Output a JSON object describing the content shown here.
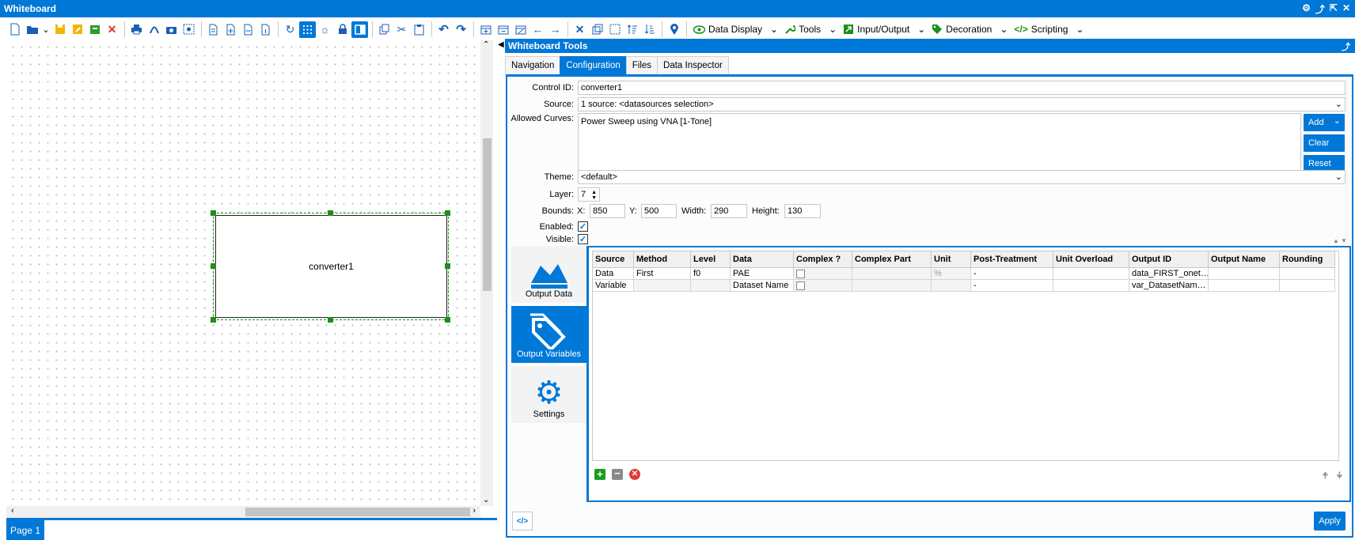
{
  "window": {
    "title": "Whiteboard"
  },
  "toolbar": {
    "menus": [
      {
        "label": "Data Display"
      },
      {
        "label": "Tools"
      },
      {
        "label": "Input/Output"
      },
      {
        "label": "Decoration"
      },
      {
        "label": "Scripting"
      }
    ]
  },
  "canvas": {
    "element_label": "converter1",
    "page_tab": "Page 1"
  },
  "panel": {
    "title": "Whiteboard Tools",
    "tabs": [
      "Navigation",
      "Configuration",
      "Files",
      "Data Inspector"
    ],
    "active_tab": "Configuration",
    "form": {
      "control_id_label": "Control ID:",
      "control_id": "converter1",
      "source_label": "Source:",
      "source": "1 source: <datasources selection>",
      "allowed_curves_label": "Allowed Curves:",
      "allowed_curves": "Power Sweep using VNA [1-Tone]",
      "add_label": "Add",
      "clear_label": "Clear",
      "reset_label": "Reset",
      "theme_label": "Theme:",
      "theme": "<default>",
      "layer_label": "Layer:",
      "layer": "7",
      "bounds_label": "Bounds:",
      "x_label": "X:",
      "x": "850",
      "y_label": "Y:",
      "y": "500",
      "width_label": "Width:",
      "width": "290",
      "height_label": "Height:",
      "height": "130",
      "enabled_label": "Enabled:",
      "visible_label": "Visible:",
      "enabled": true,
      "visible": true
    },
    "side_nav": [
      "Output Data",
      "Output Variables",
      "Settings"
    ],
    "table": {
      "columns": [
        "Source",
        "Method",
        "Level",
        "Data",
        "Complex ?",
        "Complex Part",
        "Unit",
        "Post-Treatment",
        "Unit Overload",
        "Output ID",
        "Output Name",
        "Rounding"
      ],
      "rows": [
        {
          "source": "Data",
          "method": "First",
          "level": "f0",
          "data": "PAE",
          "complex": false,
          "complex_part": "",
          "unit": "%",
          "post": "-",
          "unit_overload": "",
          "output_id": "data_FIRST_onet…",
          "output_name": "",
          "rounding": ""
        },
        {
          "source": "Variable",
          "method": "",
          "level": "",
          "data": "Dataset Name",
          "complex": false,
          "complex_part": "",
          "unit": "",
          "post": "-",
          "unit_overload": "",
          "output_id": "var_DatasetNam…",
          "output_name": "",
          "rounding": ""
        }
      ]
    },
    "apply_label": "Apply"
  },
  "colors": {
    "accent": "#0078d7",
    "selection": "#1c8f1c"
  }
}
